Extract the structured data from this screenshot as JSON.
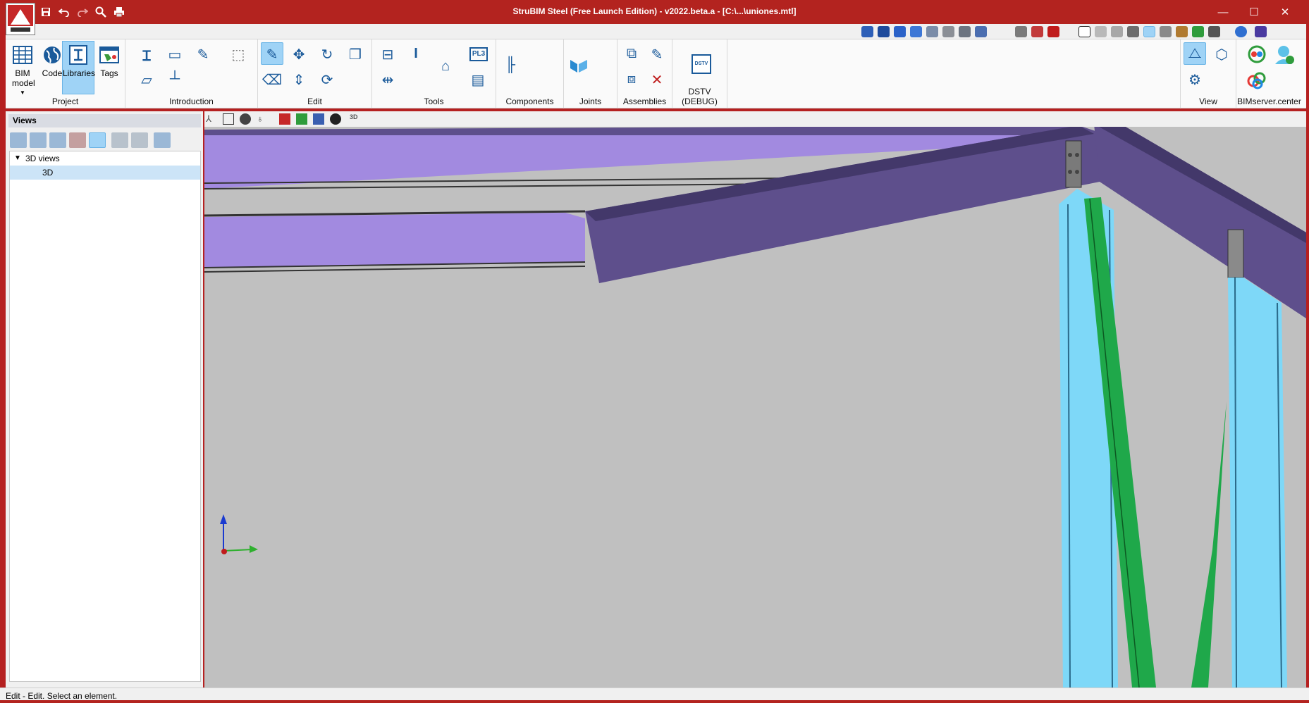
{
  "window": {
    "title": "StruBIM Steel (Free Launch Edition) - v2022.beta.a - [C:\\...\\uniones.mtl]",
    "title_bar_color": "#b3231f",
    "minimize": "—",
    "maximize": "☐",
    "close": "✕"
  },
  "quick_access": {
    "icons": [
      "save-icon",
      "undo-icon",
      "redo-icon",
      "search-icon",
      "print-icon"
    ],
    "glyphs": [
      "💾",
      "↶",
      "↷",
      "🔍",
      "🖨"
    ]
  },
  "ribbon": {
    "groups": [
      {
        "label": "Project",
        "buttons": [
          "BIM model",
          "Code",
          "Libraries",
          "Tags"
        ]
      },
      {
        "label": "Introduction"
      },
      {
        "label": "Edit"
      },
      {
        "label": "Tools"
      },
      {
        "label": "Components"
      },
      {
        "label": "Joints"
      },
      {
        "label": "Assemblies"
      },
      {
        "label": "DSTV (DEBUG)"
      },
      {
        "label": "View"
      },
      {
        "label": "BIMserver.center"
      }
    ],
    "bim_model_label": "BIM model",
    "code_label": "Code",
    "libraries_label": "Libraries",
    "tags_label": "Tags",
    "pl3_label": "PL3",
    "dstv_label": "DSTV",
    "accent": "#9fd3f6"
  },
  "views_panel": {
    "header": "Views",
    "tree": {
      "group": "3D views",
      "items": [
        "3D"
      ]
    }
  },
  "viewport_toolbar": {
    "label_3d": "3D"
  },
  "model_colors": {
    "beam_light": "#a28ae0",
    "beam_dark": "#5e4f8c",
    "column": "#7ed8f8",
    "brace": "#1fa84a",
    "background": "#c0c0c0"
  },
  "status": {
    "text": "Edit - Edit. Select an element."
  }
}
